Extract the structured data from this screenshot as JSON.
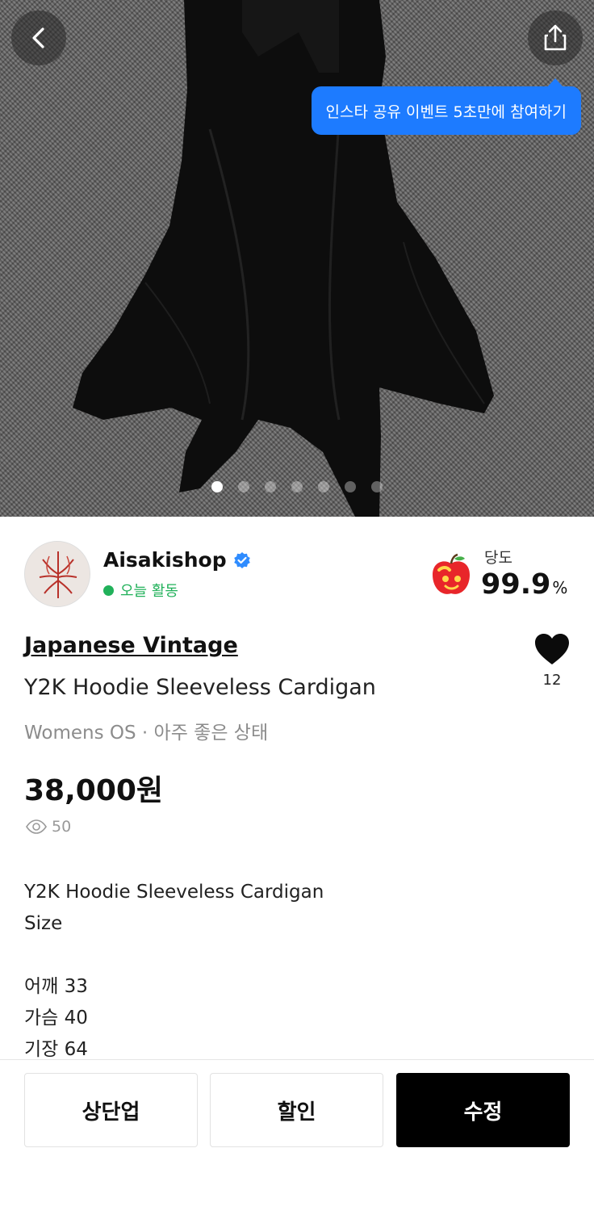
{
  "hero": {
    "tooltip_text": "인스타 공유 이벤트 5초만에 참여하기",
    "image_count": 7,
    "active_image_index": 0
  },
  "seller": {
    "name": "Aisakishop",
    "status": "오늘 활동",
    "sweetness_label": "당도",
    "sweetness_value": "99.9",
    "sweetness_unit": "%"
  },
  "product": {
    "brand": "Japanese Vintage",
    "title": "Y2K Hoodie Sleeveless Cardigan",
    "meta": "Womens OS · 아주 좋은 상태",
    "price": "38,000원",
    "views": "50",
    "likes": "12",
    "description": [
      "Y2K Hoodie Sleeveless Cardigan",
      "Size",
      "",
      "어깨 33",
      "가슴 40",
      "기장 64"
    ]
  },
  "actions": {
    "bump_label": "상단업",
    "discount_label": "할인",
    "edit_label": "수정"
  },
  "colors": {
    "accent_blue": "#1d7bff",
    "active_green": "#21b15a",
    "verified_blue": "#2f8cff"
  }
}
